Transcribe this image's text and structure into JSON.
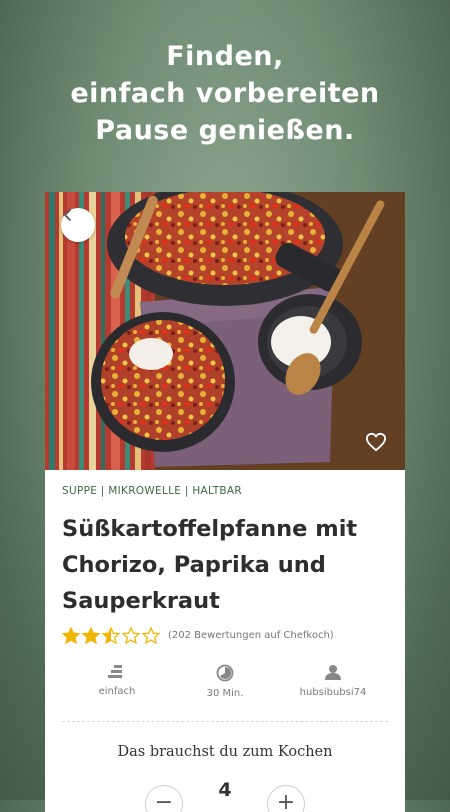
{
  "headline": {
    "line1": "Finden,",
    "line2": "einfach vorbereiten",
    "line3": "Pause genießen."
  },
  "recipe": {
    "tags": "SUPPE | MIKROWELLE | HALTBAR",
    "title": "Süßkartoffelpfanne mit Chorizo, Paprika und Sauperkraut",
    "rating_stars": 2.5,
    "rating_max": 5,
    "rating_text": "(202 Bewertungen auf Chefkoch)",
    "difficulty": "einfach",
    "time": "30 Min.",
    "author": "hubsibubsi74",
    "needs_heading": "Das brauchst du zum Kochen",
    "portions": "4"
  },
  "icons": {
    "back": "chevron-left-icon",
    "favorite": "heart-icon",
    "difficulty": "difficulty-bars-icon",
    "time": "timer-icon",
    "author": "user-icon"
  },
  "colors": {
    "star": "#f2b705",
    "tags": "#3d6a3f",
    "background": "#6f8c73"
  }
}
